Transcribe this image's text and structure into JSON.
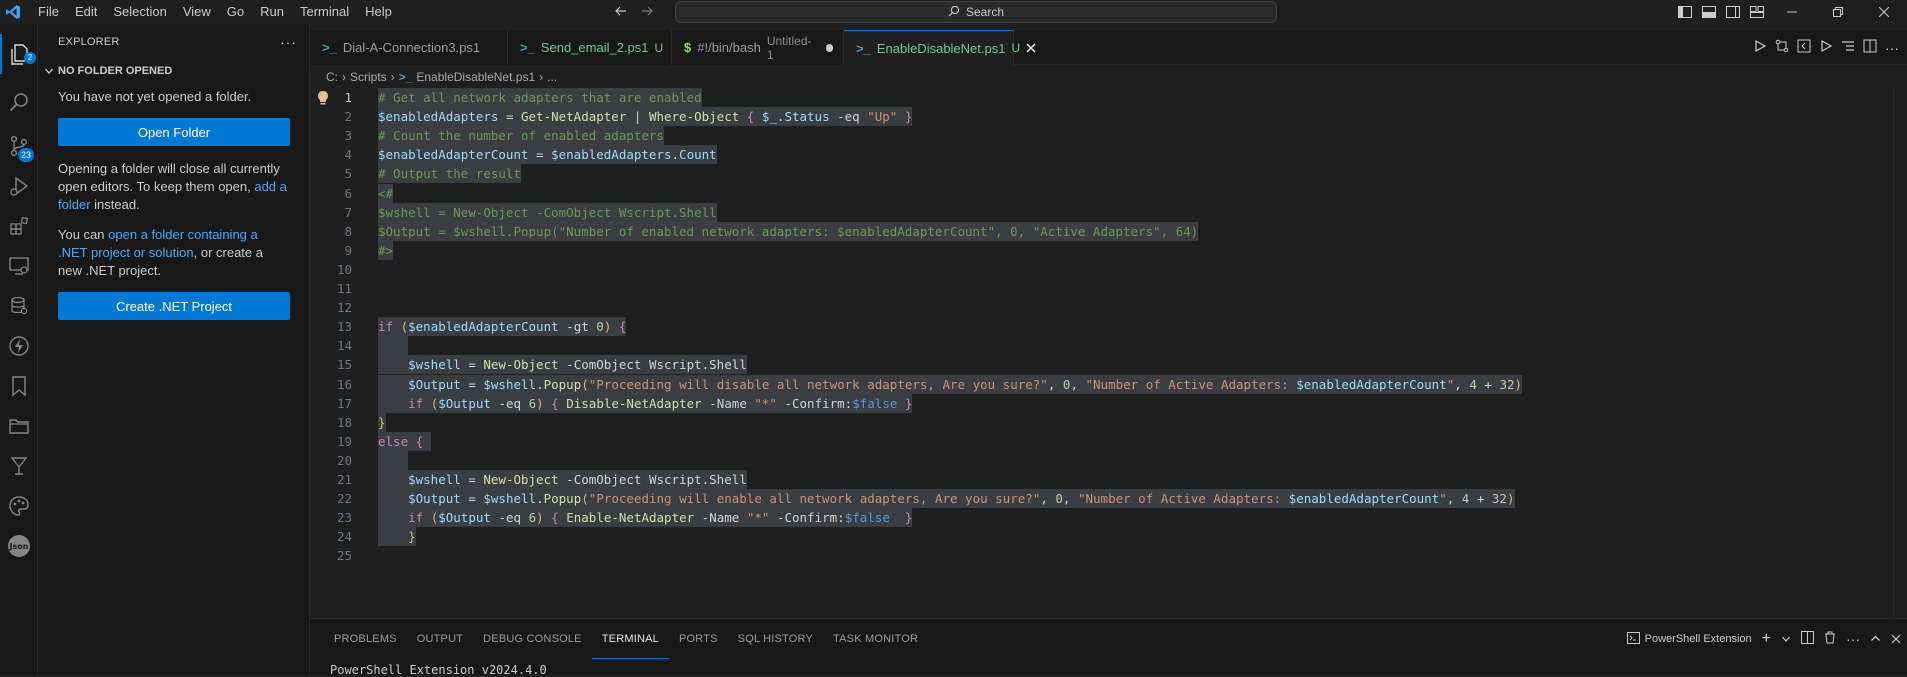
{
  "menu": [
    "File",
    "Edit",
    "Selection",
    "View",
    "Go",
    "Run",
    "Terminal",
    "Help"
  ],
  "search": {
    "label": "Search"
  },
  "activity": {
    "source_control_badge": "23",
    "explorer_badge": "2"
  },
  "sidebar": {
    "title": "EXPLORER",
    "section": "NO FOLDER OPENED",
    "msg1": "You have not yet opened a folder.",
    "open_folder": "Open Folder",
    "msg2_a": "Opening a folder will close all currently open editors. To keep them open, ",
    "msg2_link": "add a folder",
    "msg2_b": " instead.",
    "msg3_a": "You can ",
    "msg3_link": "open a folder containing a .NET project or solution",
    "msg3_b": ", or create a new .NET project.",
    "create_net": "Create .NET Project"
  },
  "tabs": [
    {
      "name": "Dial-A-Connection3.ps1",
      "status": "",
      "sub": ""
    },
    {
      "name": "Send_email_2.ps1",
      "status": "U",
      "sub": ""
    },
    {
      "name": "#!/bin/bash",
      "status": "",
      "sub": "Untitled-1"
    },
    {
      "name": "EnableDisableNet.ps1",
      "status": "U",
      "sub": ""
    }
  ],
  "breadcrumb": {
    "drive": "C:",
    "folder": "Scripts",
    "file": "EnableDisableNet.ps1",
    "more": "..."
  },
  "panel": {
    "tabs": [
      "PROBLEMS",
      "OUTPUT",
      "DEBUG CONSOLE",
      "TERMINAL",
      "PORTS",
      "SQL HISTORY",
      "TASK MONITOR"
    ],
    "active": "TERMINAL",
    "terminal_name": "PowerShell Extension",
    "terminal_text": "PowerShell Extension v2024.4.0"
  },
  "code": {
    "line_numbers": [
      "1",
      "2",
      "3",
      "4",
      "5",
      "6",
      "7",
      "8",
      "9",
      "10",
      "11",
      "12",
      "13",
      "14",
      "15",
      "16",
      "17",
      "18",
      "19",
      "20",
      "21",
      "22",
      "23",
      "24",
      "25"
    ],
    "lines": [
      [
        [
          "c-com",
          "# Get all network adapters that are enabled"
        ]
      ],
      [
        [
          "c-var",
          "$enabledAdapters"
        ],
        [
          "c-op",
          " = "
        ],
        [
          "c-fn",
          "Get-NetAdapter"
        ],
        [
          "c-op",
          " | "
        ],
        [
          "c-fn",
          "Where-Object"
        ],
        [
          "c-op",
          " "
        ],
        [
          "c-kw",
          "{"
        ],
        [
          "c-op",
          " "
        ],
        [
          "c-var",
          "$_"
        ],
        [
          "c-op",
          "."
        ],
        [
          "c-var",
          "Status"
        ],
        [
          "c-op",
          " -eq "
        ],
        [
          "c-str",
          "\"Up\""
        ],
        [
          "c-op",
          " "
        ],
        [
          "c-kw",
          "}"
        ]
      ],
      [
        [
          "c-com",
          "# Count the number of enabled adapters"
        ]
      ],
      [
        [
          "c-var",
          "$enabledAdapterCount"
        ],
        [
          "c-op",
          " = "
        ],
        [
          "c-var",
          "$enabledAdapters"
        ],
        [
          "c-op",
          "."
        ],
        [
          "c-var",
          "Count"
        ]
      ],
      [
        [
          "c-com",
          "# Output the result"
        ]
      ],
      [
        [
          "c-com",
          "<#"
        ]
      ],
      [
        [
          "c-com",
          "$wshell = New-Object -ComObject Wscript.Shell"
        ]
      ],
      [
        [
          "c-com",
          "$Output = $wshell.Popup(\"Number of enabled network adapters: $enabledAdapterCount\", 0, \"Active Adapters\", 64)"
        ]
      ],
      [
        [
          "c-com",
          "#>"
        ]
      ],
      [],
      [],
      [],
      [
        [
          "c-kw",
          "if"
        ],
        [
          "c-op",
          " "
        ],
        [
          "c-par",
          "("
        ],
        [
          "c-var",
          "$enabledAdapterCount"
        ],
        [
          "c-op",
          " -gt "
        ],
        [
          "c-num",
          "0"
        ],
        [
          "c-par",
          ")"
        ],
        [
          "c-op",
          " "
        ],
        [
          "c-kw",
          "{"
        ]
      ],
      [
        [
          "c-op",
          "    "
        ]
      ],
      [
        [
          "c-op",
          "    "
        ],
        [
          "c-var",
          "$wshell"
        ],
        [
          "c-op",
          " = "
        ],
        [
          "c-fn",
          "New-Object"
        ],
        [
          "c-op",
          " -ComObject "
        ],
        [
          "c-prm",
          "Wscript.Shell"
        ]
      ],
      [
        [
          "c-op",
          "    "
        ],
        [
          "c-var",
          "$Output"
        ],
        [
          "c-op",
          " = "
        ],
        [
          "c-var",
          "$wshell"
        ],
        [
          "c-op",
          "."
        ],
        [
          "c-fn",
          "Popup"
        ],
        [
          "c-par",
          "("
        ],
        [
          "c-str",
          "\"Proceeding will disable all network adapters, Are you sure?\""
        ],
        [
          "c-op",
          ", "
        ],
        [
          "c-num",
          "0"
        ],
        [
          "c-op",
          ", "
        ],
        [
          "c-str",
          "\"Number of Active Adapters: "
        ],
        [
          "c-var",
          "$enabledAdapterCount"
        ],
        [
          "c-str",
          "\""
        ],
        [
          "c-op",
          ", "
        ],
        [
          "c-num",
          "4"
        ],
        [
          "c-op",
          " + "
        ],
        [
          "c-num",
          "32"
        ],
        [
          "c-par",
          ")"
        ]
      ],
      [
        [
          "c-op",
          "    "
        ],
        [
          "c-kw",
          "if"
        ],
        [
          "c-op",
          " "
        ],
        [
          "c-par",
          "("
        ],
        [
          "c-var",
          "$Output"
        ],
        [
          "c-op",
          " -eq "
        ],
        [
          "c-num",
          "6"
        ],
        [
          "c-par",
          ")"
        ],
        [
          "c-op",
          " "
        ],
        [
          "c-kw",
          "{"
        ],
        [
          "c-op",
          " "
        ],
        [
          "c-fn",
          "Disable-NetAdapter"
        ],
        [
          "c-op",
          " -Name "
        ],
        [
          "c-str",
          "\"*\""
        ],
        [
          "c-op",
          " -Confirm:"
        ],
        [
          "c-blue",
          "$false"
        ],
        [
          "c-op",
          " "
        ],
        [
          "c-kw",
          "}"
        ]
      ],
      [
        [
          "c-par",
          "}"
        ]
      ],
      [
        [
          "c-kw",
          "else"
        ],
        [
          "c-op",
          " "
        ],
        [
          "c-kw",
          "{"
        ],
        [
          "c-op",
          " "
        ]
      ],
      [
        [
          "c-op",
          "    "
        ]
      ],
      [
        [
          "c-op",
          "    "
        ],
        [
          "c-var",
          "$wshell"
        ],
        [
          "c-op",
          " = "
        ],
        [
          "c-fn",
          "New-Object"
        ],
        [
          "c-op",
          " -ComObject "
        ],
        [
          "c-prm",
          "Wscript.Shell"
        ]
      ],
      [
        [
          "c-op",
          "    "
        ],
        [
          "c-var",
          "$Output"
        ],
        [
          "c-op",
          " = "
        ],
        [
          "c-var",
          "$wshell"
        ],
        [
          "c-op",
          "."
        ],
        [
          "c-fn",
          "Popup"
        ],
        [
          "c-par",
          "("
        ],
        [
          "c-str",
          "\"Proceeding will enable all network adapters, Are you sure?\""
        ],
        [
          "c-op",
          ", "
        ],
        [
          "c-num",
          "0"
        ],
        [
          "c-op",
          ", "
        ],
        [
          "c-str",
          "\"Number of Active Adapters: "
        ],
        [
          "c-var",
          "$enabledAdapterCount"
        ],
        [
          "c-str",
          "\""
        ],
        [
          "c-op",
          ", "
        ],
        [
          "c-num",
          "4"
        ],
        [
          "c-op",
          " + "
        ],
        [
          "c-num",
          "32"
        ],
        [
          "c-par",
          ")"
        ]
      ],
      [
        [
          "c-op",
          "    "
        ],
        [
          "c-kw",
          "if"
        ],
        [
          "c-op",
          " "
        ],
        [
          "c-par",
          "("
        ],
        [
          "c-var",
          "$Output"
        ],
        [
          "c-op",
          " -eq "
        ],
        [
          "c-num",
          "6"
        ],
        [
          "c-par",
          ")"
        ],
        [
          "c-op",
          " "
        ],
        [
          "c-kw",
          "{"
        ],
        [
          "c-op",
          " "
        ],
        [
          "c-fn",
          "Enable-NetAdapter"
        ],
        [
          "c-op",
          " -Name "
        ],
        [
          "c-str",
          "\"*\""
        ],
        [
          "c-op",
          " -Confirm:"
        ],
        [
          "c-blue",
          "$false"
        ],
        [
          "c-op",
          "  "
        ],
        [
          "c-kw",
          "}"
        ]
      ],
      [
        [
          "c-op",
          "    "
        ],
        [
          "c-par",
          "}"
        ]
      ],
      []
    ]
  }
}
